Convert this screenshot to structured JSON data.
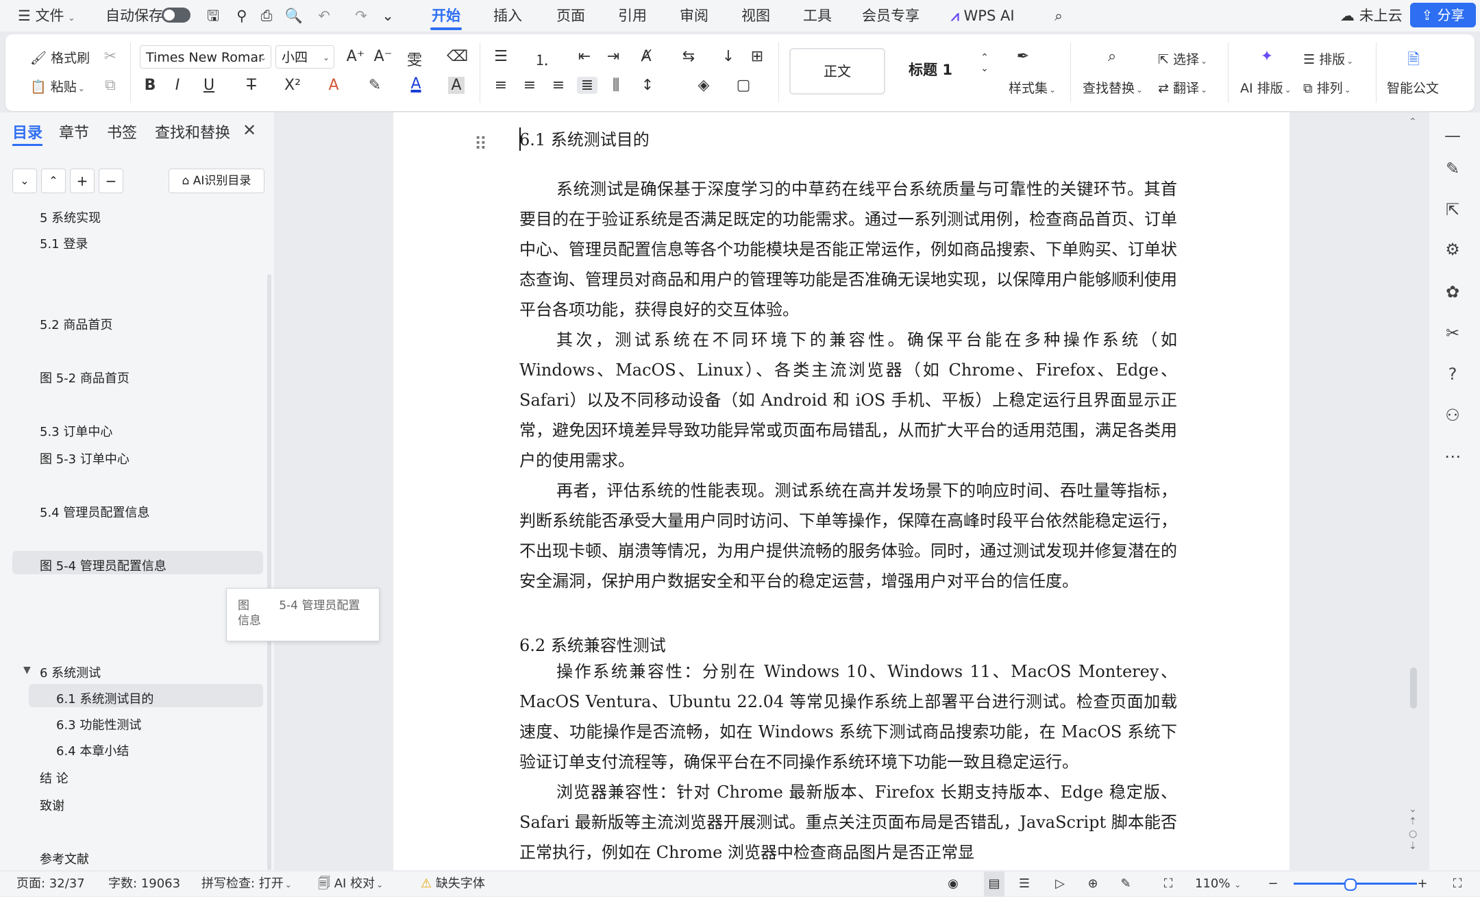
{
  "titlebar": {
    "file_menu": "文件",
    "autosave_label": "自动保存",
    "tabs": [
      "开始",
      "插入",
      "页面",
      "引用",
      "审阅",
      "视图",
      "工具",
      "会员专享"
    ],
    "wps_ai": "WPS AI",
    "cloud_status": "未上云",
    "share": "分享"
  },
  "ribbon": {
    "format_painter": "格式刷",
    "paste": "粘贴",
    "font_name": "Times New Romar",
    "font_size": "小四",
    "style_normal": "正文",
    "style_heading": "标题 1",
    "styles": "样式集",
    "find_replace": "查找替换",
    "select": "选择",
    "translate": "翻译",
    "ai_layout": "AI 排版",
    "typeset": "排版",
    "arrange": "排列",
    "smart_doc": "智能公文"
  },
  "nav": {
    "tabs": [
      "目录",
      "章节",
      "书签",
      "查找和替换"
    ],
    "ai_toc_button": "AI识别目录",
    "items": {
      "i0": "5 系统实现",
      "i1": "5.1 登录",
      "i2": "5.2 商品首页",
      "i3": "图 5-2 商品首页",
      "i4": "5.3 订单中心",
      "i5": "图 5-3 订单中心",
      "i6": "5.4 管理员配置信息",
      "i7": "图 5-4 管理员配置信息",
      "i8": "6 系统测试",
      "i9": "6.1 系统测试目的",
      "i10": "6.3 功能性测试",
      "i11": "6.4 本章小结",
      "i12": "结 论",
      "i13": "致谢",
      "i14": "参考文献"
    },
    "tooltip": "图        5-4 管理员配置信息"
  },
  "document": {
    "heading_61": "6.1 系统测试目的",
    "p1": "系统测试是确保基于深度学习的中草药在线平台系统质量与可靠性的关键环节。其首要目的在于验证系统是否满足既定的功能需求。通过一系列测试用例，检查商品首页、订单中心、管理员配置信息等各个功能模块是否能正常运作，例如商品搜索、下单购买、订单状态查询、管理员对商品和用户的管理等功能是否准确无误地实现，以保障用户能够顺利使用平台各项功能，获得良好的交互体验。",
    "p2": "其次，测试系统在不同环境下的兼容性。确保平台能在多种操作系统（如 Windows、MacOS、Linux）、各类主流浏览器（如 Chrome、Firefox、Edge、Safari）以及不同移动设备（如 Android 和 iOS 手机、平板）上稳定运行且界面显示正常，避免因环境差异导致功能异常或页面布局错乱，从而扩大平台的适用范围，满足各类用户的使用需求。",
    "p3": "再者，评估系统的性能表现。测试系统在高并发场景下的响应时间、吞吐量等指标，判断系统能否承受大量用户同时访问、下单等操作，保障在高峰时段平台依然能稳定运行，不出现卡顿、崩溃等情况，为用户提供流畅的服务体验。同时，通过测试发现并修复潜在的安全漏洞，保护用户数据安全和平台的稳定运营，增强用户对平台的信任度。",
    "heading_62": "6.2 系统兼容性测试",
    "p4": "操作系统兼容性：分别在 Windows 10、Windows 11、MacOS Monterey、MacOS Ventura、Ubuntu 22.04 等常见操作系统上部署平台进行测试。检查页面加载速度、功能操作是否流畅，如在 Windows 系统下测试商品搜索功能，在 MacOS 系统下验证订单支付流程等，确保平台在不同操作系统环境下功能一致且稳定运行。",
    "p5": "浏览器兼容性：针对 Chrome 最新版本、Firefox 长期支持版本、Edge 稳定版、Safari 最新版等主流浏览器开展测试。重点关注页面布局是否错乱，JavaScript 脚本能否正常执行，例如在 Chrome 浏览器中检查商品图片是否正常显"
  },
  "status": {
    "page": "页面: 32/37",
    "words": "字数: 19063",
    "spell": "拼写检查: 打开",
    "ai_check": "AI 校对",
    "missing_font": "缺失字体",
    "zoom": "110%"
  },
  "colors": {
    "accent": "#2d6ef2",
    "pane_bg": "#f4f5f7",
    "doc_bg": "#ffffff"
  }
}
